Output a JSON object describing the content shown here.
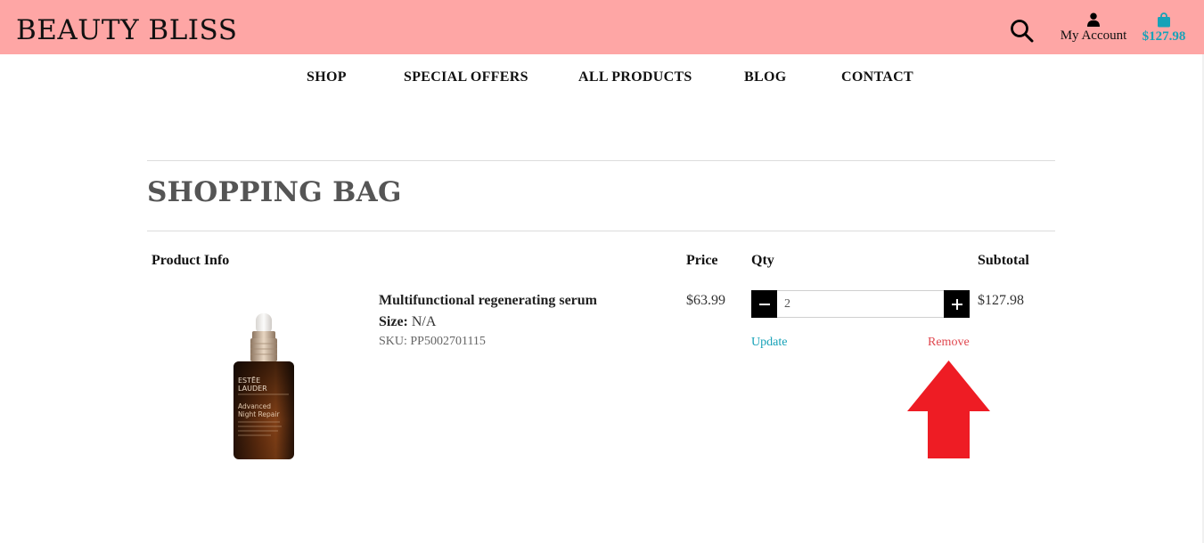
{
  "header": {
    "brand": "BEAUTY BLISS",
    "account_label": "My Account",
    "cart_total": "$127.98",
    "bg_color": "#fea6a5",
    "accent_color": "#17a2b8"
  },
  "nav": {
    "items": [
      {
        "label": "SHOP"
      },
      {
        "label": "SPECIAL OFFERS"
      },
      {
        "label": "ALL PRODUCTS"
      },
      {
        "label": "BLOG"
      },
      {
        "label": "CONTACT"
      }
    ]
  },
  "page": {
    "title": "SHOPPING BAG"
  },
  "table": {
    "headers": {
      "product_info": "Product Info",
      "price": "Price",
      "qty": "Qty",
      "subtotal": "Subtotal"
    }
  },
  "item": {
    "name": "Multifunctional regenerating serum",
    "size_label": "Size:",
    "size_value": "N/A",
    "sku": "SKU: PP5002701115",
    "price": "$63.99",
    "qty": "2",
    "subtotal": "$127.98",
    "update_label": "Update",
    "remove_label": "Remove",
    "image_text": {
      "brand_line1": "ESTĒE",
      "brand_line2": "LAUDER",
      "product_line1": "Advanced",
      "product_line2": "Night Repair"
    }
  },
  "icons": {
    "search": "search-icon",
    "account": "user-icon",
    "cart": "shopping-bag-icon",
    "minus": "minus-icon",
    "plus": "plus-icon"
  },
  "annotation": {
    "arrow_color": "#ee1c24"
  }
}
